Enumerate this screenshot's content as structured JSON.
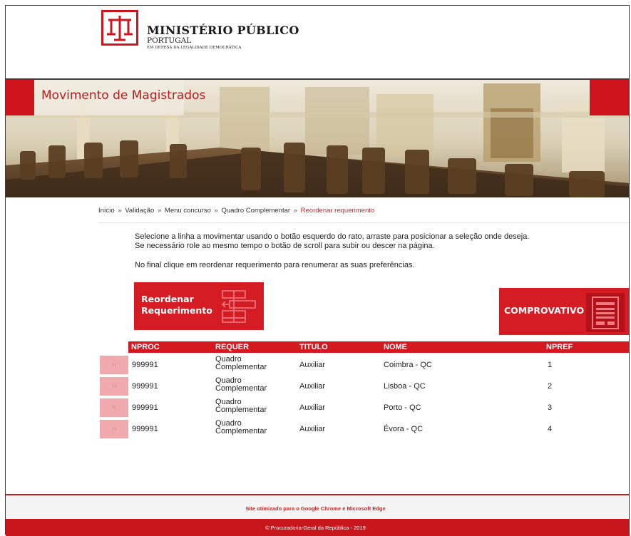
{
  "header": {
    "logo_title": "MINISTÉRIO PÚBLICO",
    "logo_subtitle": "PORTUGAL",
    "logo_tagline": "EM DEFESA DA LEGALIDADE DEMOCRÁTICA"
  },
  "banner": {
    "title": "Movimento de Magistrados"
  },
  "breadcrumb": {
    "items": [
      "Início",
      "Validação",
      "Menu concurso",
      "Quadro Complementar"
    ],
    "separator": "»",
    "current": "Reordenar requerimento"
  },
  "instructions": {
    "line1": "Selecione a linha a movimentar usando o botão esquerdo do rato, arraste para posicionar a seleção onde deseja.",
    "line2": "Se necessário role ao mesmo tempo o botão de scroll para subir ou descer na página.",
    "line3": "No final clique em reordenar requerimento para renumerar as suas preferências."
  },
  "buttons": {
    "reorder_line1": "Reordenar",
    "reorder_line2": "Requerimento",
    "comprovativo": "COMPROVATIVO"
  },
  "table": {
    "columns": [
      "NPROC",
      "REQUER",
      "TITULO",
      "NOME",
      "NPREF"
    ],
    "rows": [
      {
        "handle": "↑↓",
        "nproc": "999991",
        "requer_1": "Quadro",
        "requer_2": "Complementar",
        "titulo": "Auxiliar",
        "nome": "Coimbra - QC",
        "npref": "1"
      },
      {
        "handle": "↑↓",
        "nproc": "999991",
        "requer_1": "Quadro",
        "requer_2": "Complementar",
        "titulo": "Auxiliar",
        "nome": "Lisboa - QC",
        "npref": "2"
      },
      {
        "handle": "↑↓",
        "nproc": "999991",
        "requer_1": "Quadro",
        "requer_2": "Complementar",
        "titulo": "Auxiliar",
        "nome": "Porto - QC",
        "npref": "3"
      },
      {
        "handle": "↑↓",
        "nproc": "999991",
        "requer_1": "Quadro",
        "requer_2": "Complementar",
        "titulo": "Auxiliar",
        "nome": "Évora - QC",
        "npref": "4"
      }
    ]
  },
  "footer": {
    "note": "Site otimizado para o Google Chrome e Microsoft Edge",
    "copyright": "© Procuradoria-Geral da República - 2019"
  },
  "colors": {
    "brand_red": "#d51b23",
    "handle_pink": "#f0a9ad",
    "breadcrumb_current": "#c62828"
  },
  "icons": {
    "logo": "scales-of-justice-logo-icon",
    "reorder": "reorder-list-icon",
    "comprovativo": "document-icon",
    "drag_handle": "drag-handle-icon"
  }
}
